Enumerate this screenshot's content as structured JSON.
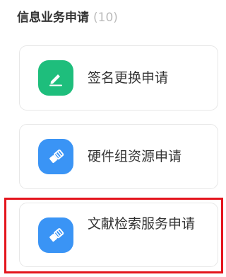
{
  "section": {
    "title": "信息业务申请",
    "count": "(10)"
  },
  "cards": [
    {
      "label": "签名更换申请",
      "icon": "pen-sign-icon",
      "icon_color": "#1ebe7c"
    },
    {
      "label": "硬件组资源申请",
      "icon": "eraser-icon",
      "icon_color": "#3a94f5"
    },
    {
      "label": "文献检索服务申请",
      "icon": "eraser-icon",
      "icon_color": "#3a94f5",
      "highlighted": true
    }
  ],
  "colors": {
    "highlight": "#e4151d",
    "title_text": "#333333",
    "count_text": "#bbbbbb",
    "card_border": "#e7e7e7"
  }
}
